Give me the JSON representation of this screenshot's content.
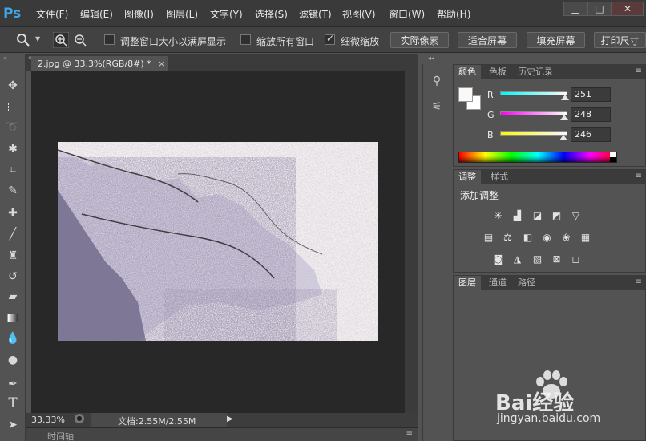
{
  "app": {
    "logo": "Ps"
  },
  "menu": [
    {
      "label": "文件(F)"
    },
    {
      "label": "编辑(E)"
    },
    {
      "label": "图像(I)"
    },
    {
      "label": "图层(L)"
    },
    {
      "label": "文字(Y)"
    },
    {
      "label": "选择(S)"
    },
    {
      "label": "滤镜(T)"
    },
    {
      "label": "视图(V)"
    },
    {
      "label": "窗口(W)"
    },
    {
      "label": "帮助(H)"
    }
  ],
  "window_buttons": {
    "minimize": "▁",
    "restore": "□",
    "close": "✕"
  },
  "options": {
    "resize_windows_label": "调整窗口大小以满屏显示",
    "zoom_all_label": "缩放所有窗口",
    "scrubby_zoom_label": "细微缩放",
    "scrubby_zoom_checked": true,
    "actual_pixels": "实际像素",
    "fit_screen": "适合屏幕",
    "fill_screen": "填充屏幕",
    "print_size": "打印尺寸"
  },
  "document": {
    "tab_title": "2.jpg @ 33.3%(RGB/8#) *",
    "tab_close": "×"
  },
  "status": {
    "zoom": "33.33%",
    "doc_info": "文档:2.55M/2.55M",
    "arrow": "▶"
  },
  "timeline": {
    "label": "时间轴"
  },
  "color_panel": {
    "tabs": [
      "颜色",
      "色板",
      "历史记录"
    ],
    "foreground": "#fbf8f6",
    "background": "#ffffff",
    "r": {
      "label": "R",
      "value": "251",
      "fraction": 0.984
    },
    "g": {
      "label": "G",
      "value": "248",
      "fraction": 0.973
    },
    "b": {
      "label": "B",
      "value": "246",
      "fraction": 0.965
    }
  },
  "adjust_panel": {
    "tabs": [
      "调整",
      "样式"
    ],
    "title": "添加调整"
  },
  "layers_panel": {
    "tabs": [
      "图层",
      "通道",
      "路径"
    ]
  },
  "panel_menu_icon": "≡",
  "watermark": {
    "brand": "Bai经验",
    "url": "jingyan.baidu.com"
  }
}
